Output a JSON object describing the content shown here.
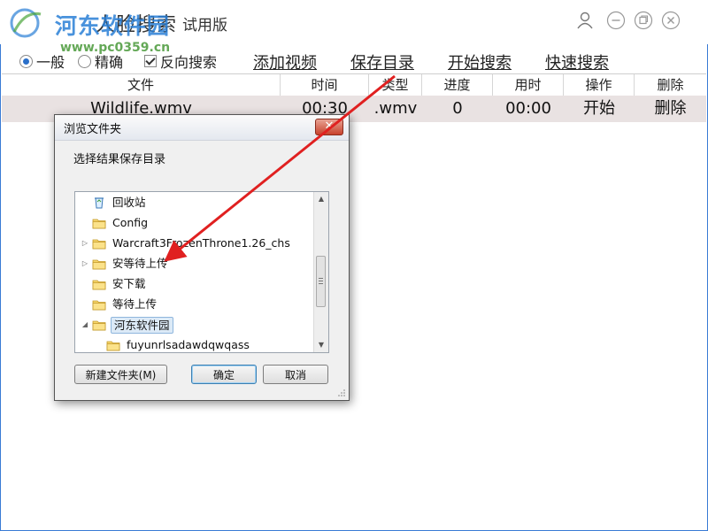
{
  "app": {
    "title": "人脸搜索",
    "edition": "试用版"
  },
  "watermark": {
    "name": "河东软件园",
    "url": "www.pc0359.cn"
  },
  "options": {
    "mode_general": "一般",
    "mode_precise": "精确",
    "reverse_search": "反向搜索",
    "selected_mode": "一般",
    "reverse_checked": true
  },
  "actions": {
    "add_video": "添加视频",
    "save_dir": "保存目录",
    "start_search": "开始搜索",
    "quick_search": "快速搜索"
  },
  "table": {
    "headers": [
      "文件",
      "时间",
      "类型",
      "进度",
      "用时",
      "操作",
      "删除"
    ],
    "rows": [
      {
        "file": "Wildlife.wmv",
        "time": "00:30",
        "type": ".wmv",
        "progress": "0",
        "elapsed": "00:00",
        "action": "开始",
        "delete": "删除"
      }
    ]
  },
  "dialog": {
    "title": "浏览文件夹",
    "prompt": "选择结果保存目录",
    "close": "✕",
    "tree": [
      {
        "label": "回收站",
        "icon": "recycle-bin-icon",
        "expander": ""
      },
      {
        "label": "Config",
        "icon": "folder-icon",
        "expander": ""
      },
      {
        "label": "Warcraft3FrozenThrone1.26_chs",
        "icon": "folder-icon",
        "expander": "▷"
      },
      {
        "label": "安等待上传",
        "icon": "folder-icon",
        "expander": "▷"
      },
      {
        "label": "安下载",
        "icon": "folder-icon",
        "expander": ""
      },
      {
        "label": "等待上传",
        "icon": "folder-icon",
        "expander": ""
      },
      {
        "label": "河东软件园",
        "icon": "folder-icon",
        "expander": "◢",
        "selected": true
      },
      {
        "label": "fuyunrlsadawdqwqass",
        "icon": "folder-icon",
        "expander": ""
      }
    ],
    "new_folder": "新建文件夹(M)",
    "ok": "确定",
    "cancel": "取消"
  },
  "colors": {
    "accent": "#2a6fc9",
    "row_bg": "#e9e2e2",
    "annotation_arrow": "#e02020"
  }
}
